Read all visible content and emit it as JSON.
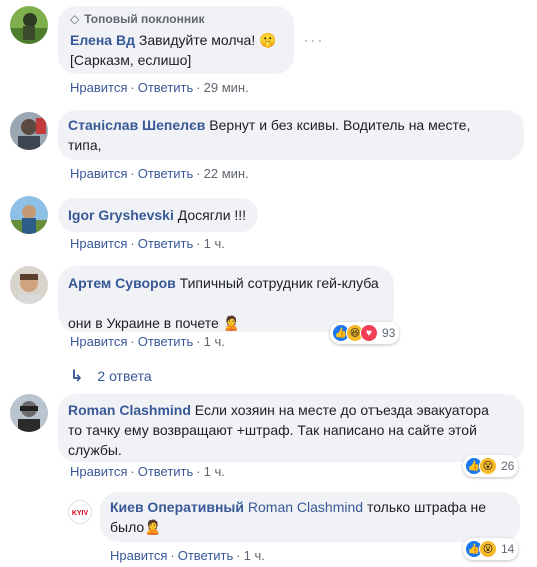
{
  "actions": {
    "like": "Нравится",
    "reply": "Ответить",
    "sep": "·"
  },
  "comments": [
    {
      "badge": "Топовый поклонник",
      "author": "Елена Вд",
      "text": "Завидуйте молча! 🤫\n[Сарказм, еслишо]",
      "time": "29 мин."
    },
    {
      "author": "Станіслав Шепелєв",
      "text": "Вернут и без ксивы. Водитель на месте,\nтипа,",
      "time": "22 мин."
    },
    {
      "author": "Igor Gryshevski",
      "text": "Досягли !!!",
      "time": "1 ч."
    },
    {
      "author": "Артем Суворов",
      "text": "Типичный сотрудник гей-клуба\n\nони в Украине в почете 🙎",
      "time": "1 ч.",
      "reactions": "93"
    },
    {
      "author": "Roman Clashmind",
      "text": "Если хозяин на месте до отъезда эвакуатора\nто тачку ему возвращают +штраф. Так написано на сайте этой\nслужбы.",
      "time": "1 ч.",
      "reactions": "26"
    }
  ],
  "replies_label": "2 ответа",
  "reply": {
    "author": "Киев Оперативный",
    "mention": "Roman Clashmind",
    "text": " только штрафа не\nбыло🙎",
    "time": "1 ч.",
    "reactions": "14",
    "logo_text": "KYIV"
  },
  "colors": {
    "link": "#385898",
    "bubble": "#f0f2f5",
    "meta": "#606770"
  }
}
